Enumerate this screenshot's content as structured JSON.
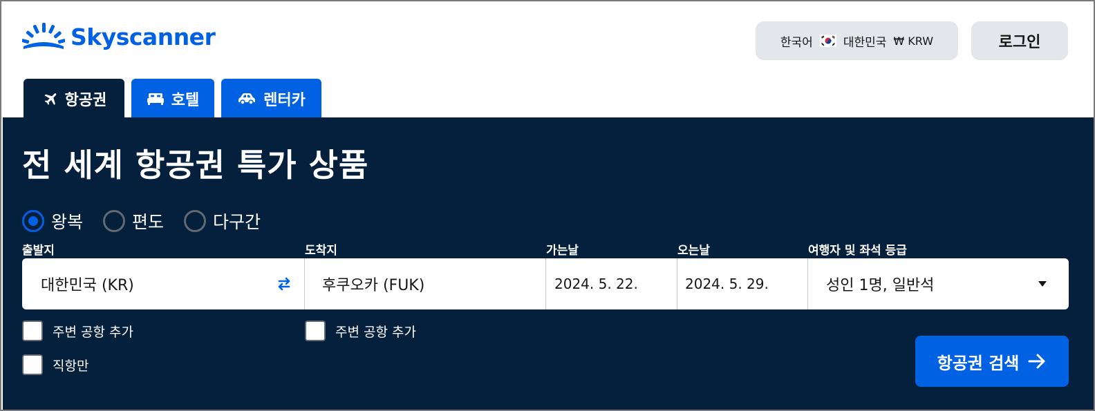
{
  "brand": {
    "name": "Skyscanner",
    "color": "#0062e3"
  },
  "header": {
    "language": "한국어",
    "country": "대한민국",
    "currency": "₩ KRW",
    "login_label": "로그인"
  },
  "tabs": [
    {
      "label": "항공권",
      "icon": "plane-icon",
      "active": true
    },
    {
      "label": "호텔",
      "icon": "bed-icon",
      "active": false
    },
    {
      "label": "렌터카",
      "icon": "car-icon",
      "active": false
    }
  ],
  "search": {
    "headline": "전 세계 항공권 특가 상품",
    "trip_types": [
      {
        "label": "왕복",
        "selected": true
      },
      {
        "label": "편도",
        "selected": false
      },
      {
        "label": "다구간",
        "selected": false
      }
    ],
    "labels": {
      "origin": "출발지",
      "destination": "도착지",
      "depart": "가는날",
      "return": "오는날",
      "travellers": "여행자 및 좌석 등급"
    },
    "origin": "대한민국 (KR)",
    "destination": "후쿠오카 (FUK)",
    "depart_date": "2024. 5. 22.",
    "return_date": "2024. 5. 29.",
    "travellers": "성인 1명, 일반석",
    "nearby_origin": "주변 공항 추가",
    "nearby_destination": "주변 공항 추가",
    "direct_only": "직항만",
    "button_label": "항공권 검색"
  },
  "colors": {
    "panel": "#05203c",
    "accent": "#0062e3",
    "pill": "#e3e6ea"
  }
}
